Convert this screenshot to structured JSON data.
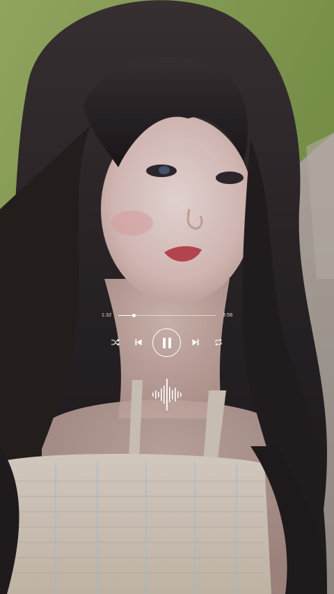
{
  "player": {
    "elapsed": "1:32",
    "total": "3:56",
    "progress": 0.16,
    "state": "playing"
  },
  "controls": {
    "shuffle_icon": "shuffle-icon",
    "previous_icon": "skip-previous-icon",
    "play_pause_icon": "pause-icon",
    "next_icon": "skip-next-icon",
    "repeat_icon": "repeat-icon"
  },
  "visualizer": {
    "icon": "audio-waveform-icon"
  },
  "colors": {
    "ui": "#ffffff",
    "ui_dim": "#eae4e2",
    "grass": "#8fa55a",
    "hair": "#2a2528",
    "skin": "#e9d3cf",
    "dress": "#d9cdbe"
  }
}
